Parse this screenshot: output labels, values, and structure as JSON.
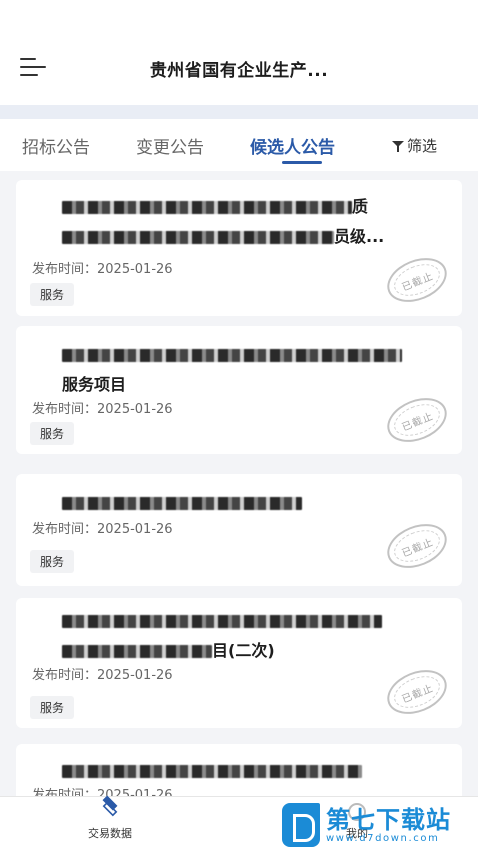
{
  "header": {
    "title": "贵州省国有企业生产...",
    "menu_icon": "menu-icon"
  },
  "tabs": [
    {
      "label": "招标公告",
      "active": false
    },
    {
      "label": "变更公告",
      "active": false
    },
    {
      "label": "候选人公告",
      "active": true
    }
  ],
  "filter": {
    "label": "筛选",
    "icon": "filter-icon"
  },
  "cards": [
    {
      "title_line1": "质",
      "title_line2": "员级...",
      "date": "发布时间：2025-01-26",
      "tag": "服务",
      "stamp": "已截止"
    },
    {
      "title_line1": "",
      "title_line2": "服务项目",
      "date": "发布时间：2025-01-26",
      "tag": "服务",
      "stamp": "已截止"
    },
    {
      "title_line1": "",
      "title_line2": "",
      "date": "发布时间：2025-01-26",
      "tag": "服务",
      "stamp": "已截止"
    },
    {
      "title_line1": "",
      "title_line2": "目(二次)",
      "date": "发布时间：2025-01-26",
      "tag": "服务",
      "stamp": "已截止"
    },
    {
      "title_line1": "",
      "title_line2": "",
      "date": "发布时间：2025-01-26",
      "tag": "",
      "stamp": ""
    }
  ],
  "bottom_nav": [
    {
      "label": "交易数据",
      "icon": "layers-icon",
      "active": true
    },
    {
      "label": "我的",
      "icon": "person-icon",
      "active": false
    }
  ],
  "watermark": {
    "text": "第七下载站",
    "url": "www.d7down.com"
  },
  "colors": {
    "accent": "#2b5aa8",
    "watermark": "#1b8bd6"
  }
}
